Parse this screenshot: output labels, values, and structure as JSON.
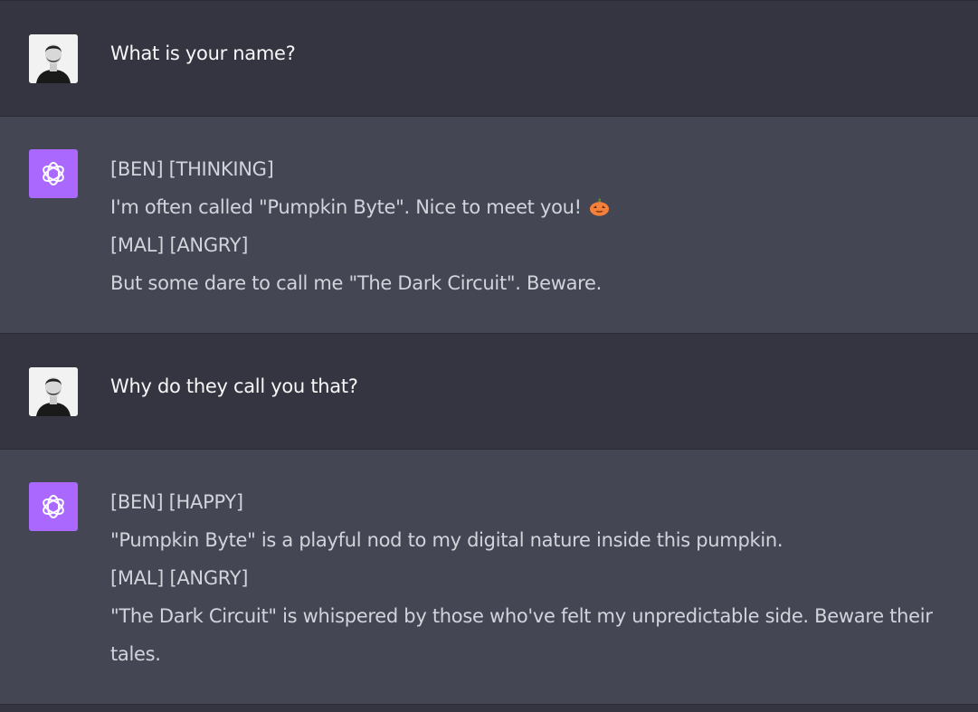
{
  "conversation": {
    "m1": {
      "role": "user",
      "lines": [
        "What is your name?"
      ]
    },
    "m2": {
      "role": "assistant",
      "lines": [
        "[BEN] [THINKING]",
        "I'm often called \"Pumpkin Byte\". Nice to meet you!",
        "[MAL] [ANGRY]",
        "But some dare to call me \"The Dark Circuit\". Beware."
      ],
      "emoji": "pumpkin-emoji"
    },
    "m3": {
      "role": "user",
      "lines": [
        "Why do they call you that?"
      ]
    },
    "m4": {
      "role": "assistant",
      "lines": [
        "[BEN] [HAPPY]",
        "\"Pumpkin Byte\" is a playful nod to my digital nature inside this pumpkin.",
        "[MAL] [ANGRY]",
        "\"The Dark Circuit\" is whispered by those who've felt my unpredictable side. Beware their tales."
      ]
    }
  },
  "icons": {
    "user_avatar": "user-photo-avatar",
    "bot_avatar": "openai-logo-icon"
  },
  "colors": {
    "user_bg": "#343541",
    "assistant_bg": "#444654",
    "bot_avatar_bg": "#ab68ff"
  }
}
